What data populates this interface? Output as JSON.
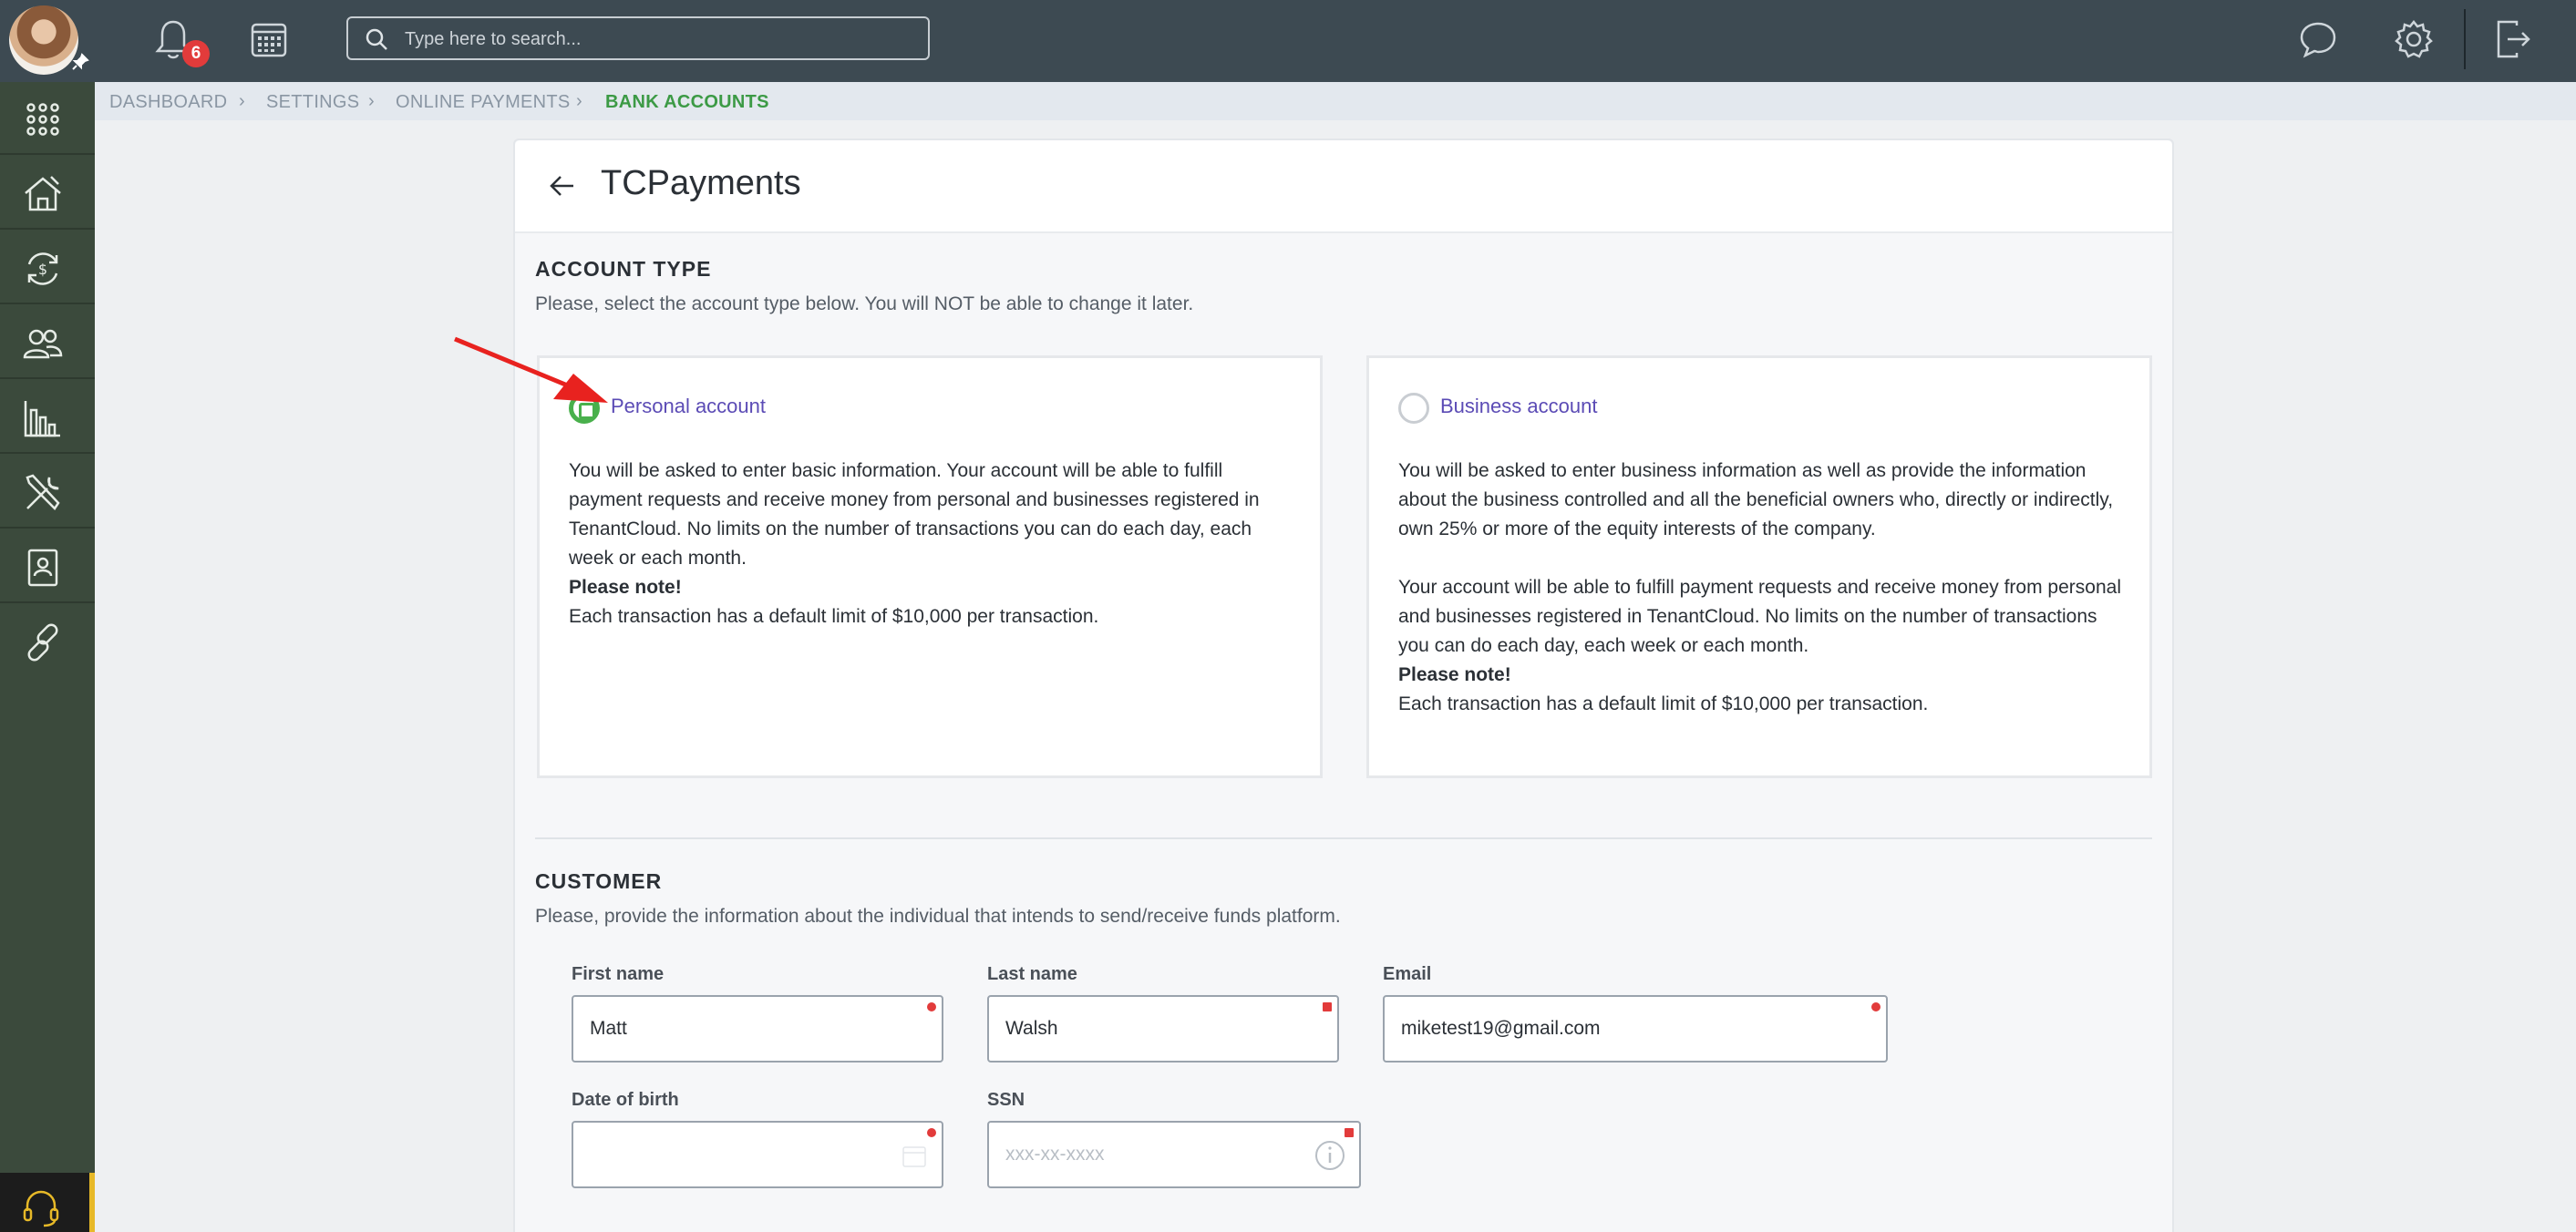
{
  "topbar": {
    "notification_count": "6",
    "search_placeholder": "Type here to search..."
  },
  "breadcrumb": [
    "DASHBOARD",
    "SETTINGS",
    "ONLINE PAYMENTS",
    "BANK ACCOUNTS"
  ],
  "page": {
    "title": "TCPayments"
  },
  "account_type": {
    "title": "ACCOUNT TYPE",
    "description": "Please, select the account type below. You will NOT be able to change it later.",
    "personal": {
      "label": "Personal account",
      "selected": true,
      "text1": "You will be asked to enter basic information. Your account will be able to fulfill payment requests and receive money from personal and businesses registered in TenantCloud. No limits on the number of transactions you can do each day, each week or each month.",
      "note_title": "Please note!",
      "note_text": "Each transaction has a default limit of $10,000 per transaction."
    },
    "business": {
      "label": "Business account",
      "selected": false,
      "text1": "You will be asked to enter business information as well as provide the information about the business controlled and all the beneficial owners who, directly or indirectly, own 25% or more of the equity interests of the company.",
      "text2": "Your account will be able to fulfill payment requests and receive money from personal and businesses registered in TenantCloud. No limits on the number of transactions you can do each day, each week or each month.",
      "note_title": "Please note!",
      "note_text": "Each transaction has a default limit of $10,000 per transaction."
    }
  },
  "customer": {
    "title": "CUSTOMER",
    "description": "Please, provide the information about the individual that intends to send/receive funds platform.",
    "first_name": {
      "label": "First name",
      "value": "Matt"
    },
    "last_name": {
      "label": "Last name",
      "value": "Walsh"
    },
    "email": {
      "label": "Email",
      "value": "miketest19@gmail.com"
    },
    "dob": {
      "label": "Date of birth",
      "value": ""
    },
    "ssn": {
      "label": "SSN",
      "placeholder": "xxx-xx-xxxx"
    }
  },
  "colors": {
    "topbar": "#3d4a52",
    "sidebar": "#3b4a3c",
    "accent_green": "#49b04c",
    "link_purple": "#5b4bb5",
    "required_red": "#e23b3b"
  }
}
